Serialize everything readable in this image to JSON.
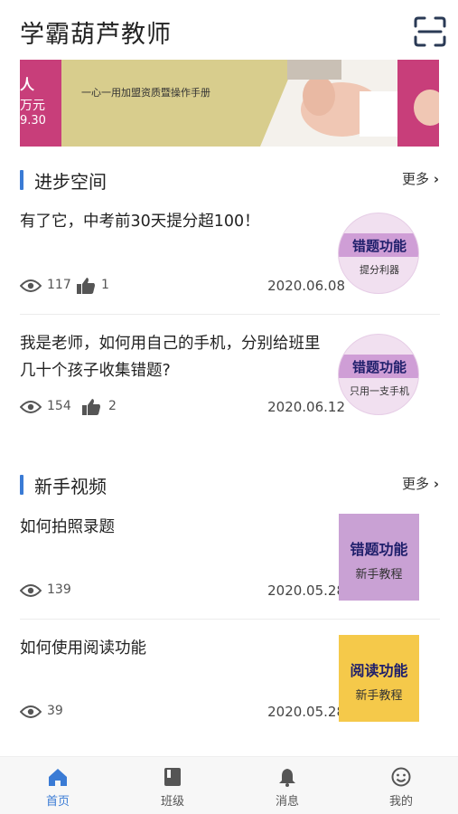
{
  "app": {
    "title": "学霸葫芦教师"
  },
  "icons": {
    "scan": "scan-frame-icon",
    "eye": "eye-icon",
    "thumb": "thumbs-up-icon",
    "chevron": "chevron-right-icon"
  },
  "colors": {
    "accent": "#3a7bd5",
    "banner_pink": "#c83e7a",
    "banner_gold": "#d8cd8d"
  },
  "banner": {
    "left_line1": "人",
    "left_line2": "万元",
    "left_line3": "9.30",
    "text": "一心一用加盟资质暨操作手册"
  },
  "progress_section": {
    "title": "进步空间",
    "more": "更多",
    "articles": [
      {
        "title": "有了它，中考前30天提分超100！",
        "views": "117",
        "likes": "1",
        "date": "2020.06.08",
        "thumb_title": "错题功能",
        "thumb_sub": "提分利器"
      },
      {
        "title": "我是老师，如何用自己的手机，分别给班里几十个孩子收集错题?",
        "views": "154",
        "likes": "2",
        "date": "2020.06.12",
        "thumb_title": "错题功能",
        "thumb_sub": "只用一支手机"
      }
    ]
  },
  "video_section": {
    "title": "新手视频",
    "more": "更多",
    "articles": [
      {
        "title": "如何拍照录题",
        "views": "139",
        "date": "2020.05.28",
        "thumb_title": "错题功能",
        "thumb_sub": "新手教程",
        "thumb_color": "#c9a1d4"
      },
      {
        "title": "如何使用阅读功能",
        "views": "39",
        "date": "2020.05.28",
        "thumb_title": "阅读功能",
        "thumb_sub": "新手教程",
        "thumb_color": "#f5c94a"
      }
    ]
  },
  "tabbar": {
    "items": [
      {
        "label": "首页",
        "icon": "home-icon",
        "active": true
      },
      {
        "label": "班级",
        "icon": "book-icon",
        "active": false
      },
      {
        "label": "消息",
        "icon": "bell-icon",
        "active": false
      },
      {
        "label": "我的",
        "icon": "smiley-icon",
        "active": false
      }
    ]
  }
}
